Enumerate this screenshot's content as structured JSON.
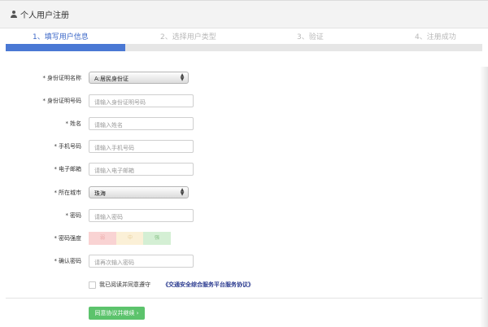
{
  "header": {
    "title": "个人用户注册",
    "icon": "user-icon"
  },
  "steps": [
    {
      "label": "1、填写用户信息",
      "active": true
    },
    {
      "label": "2、选择用户类型",
      "active": false
    },
    {
      "label": "3、验证",
      "active": false
    },
    {
      "label": "4、注册成功",
      "active": false
    }
  ],
  "progress": {
    "current_step": 1,
    "total_steps": 4,
    "fraction": 0.25
  },
  "form": {
    "required_mark": "*",
    "id_type": {
      "label": "身份证明名称",
      "value": "A:居民身份证"
    },
    "id_number": {
      "label": "身份证明号码",
      "placeholder": "请输入身份证明号码"
    },
    "name": {
      "label": "姓名",
      "placeholder": "请输入姓名"
    },
    "phone": {
      "label": "手机号码",
      "placeholder": "请输入手机号码"
    },
    "email": {
      "label": "电子邮箱",
      "placeholder": "请输入电子邮箱"
    },
    "city": {
      "label": "所在城市",
      "value": "珠海"
    },
    "password": {
      "label": "密码",
      "placeholder": "请输入密码"
    },
    "strength": {
      "label": "密码强度",
      "levels": [
        "弱",
        "中",
        "强"
      ]
    },
    "confirm_password": {
      "label": "确认密码",
      "placeholder": "请再次输入密码"
    }
  },
  "agreement": {
    "text": "我已阅读并同意遵守",
    "link": "《交通安全综合服务平台服务协议》",
    "checked": false
  },
  "submit_label": "同意协议并继续 ›",
  "colors": {
    "accent": "#4a78d4",
    "submit": "#5cc36c"
  }
}
